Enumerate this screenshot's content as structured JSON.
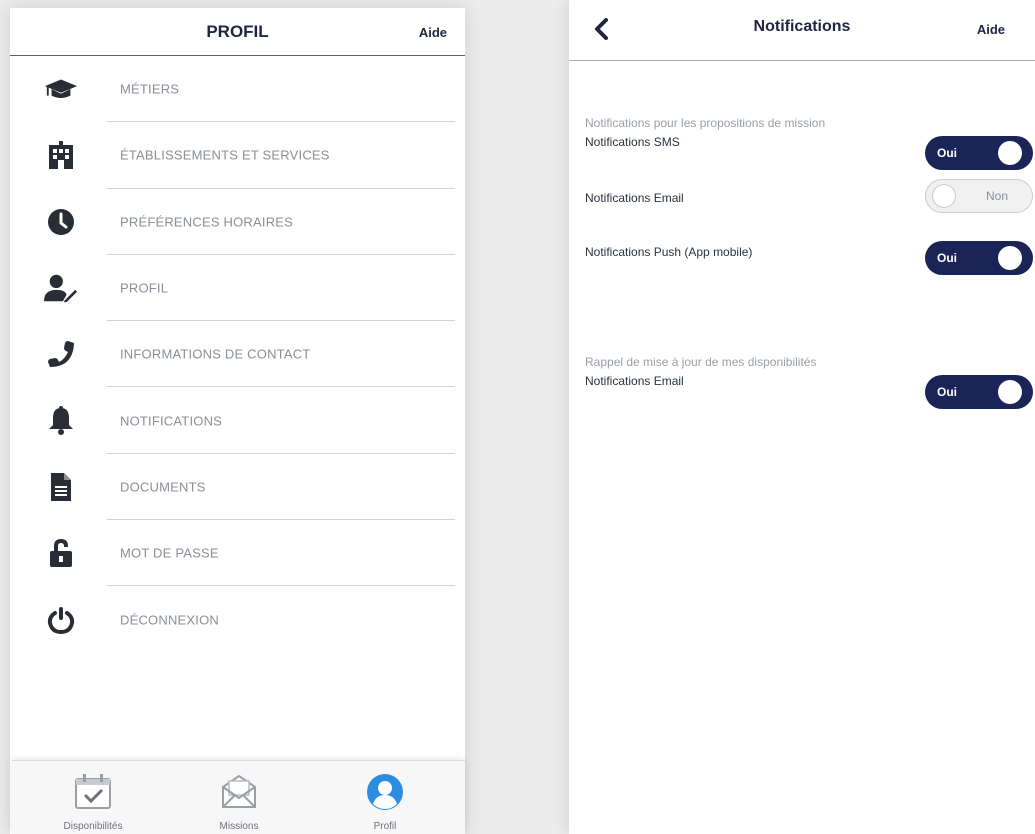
{
  "colors": {
    "navy": "#1b2456",
    "title_text": "#1f2540",
    "menu_text": "#8a8e97",
    "icon_dark": "#2a2d36",
    "tab_active": "#2b8de0"
  },
  "left_screen": {
    "header": {
      "title": "PROFIL",
      "help": "Aide"
    },
    "menu": [
      {
        "icon": "graduation-cap-icon",
        "label": "MÉTIERS"
      },
      {
        "icon": "building-icon",
        "label": "ÉTABLISSEMENTS ET SERVICES"
      },
      {
        "icon": "clock-icon",
        "label": "PRÉFÉRENCES HORAIRES"
      },
      {
        "icon": "user-edit-icon",
        "label": "PROFIL"
      },
      {
        "icon": "phone-icon",
        "label": "INFORMATIONS DE CONTACT"
      },
      {
        "icon": "bell-icon",
        "label": "NOTIFICATIONS"
      },
      {
        "icon": "document-icon",
        "label": "DOCUMENTS"
      },
      {
        "icon": "unlock-icon",
        "label": "MOT DE PASSE"
      },
      {
        "icon": "power-icon",
        "label": "DÉCONNEXION"
      }
    ],
    "tabs": [
      {
        "icon": "calendar-check-icon",
        "label": "Disponibilités",
        "active": false
      },
      {
        "icon": "envelope-icon",
        "label": "Missions",
        "active": false
      },
      {
        "icon": "user-circle-icon",
        "label": "Profil",
        "active": true
      }
    ]
  },
  "right_screen": {
    "header": {
      "back_icon": "chevron-left-icon",
      "title": "Notifications",
      "help": "Aide"
    },
    "sections": [
      {
        "title": "Notifications pour les propositions de mission",
        "settings": [
          {
            "label": "Notifications SMS",
            "value": "Oui",
            "enabled": true
          },
          {
            "label": "Notifications Email",
            "value": "Non",
            "enabled": false
          },
          {
            "label": "Notifications Push (App mobile)",
            "value": "Oui",
            "enabled": true
          }
        ]
      },
      {
        "title": "Rappel de mise à jour de mes disponibilités",
        "settings": [
          {
            "label": "Notifications Email",
            "value": "Oui",
            "enabled": true
          }
        ]
      }
    ]
  }
}
